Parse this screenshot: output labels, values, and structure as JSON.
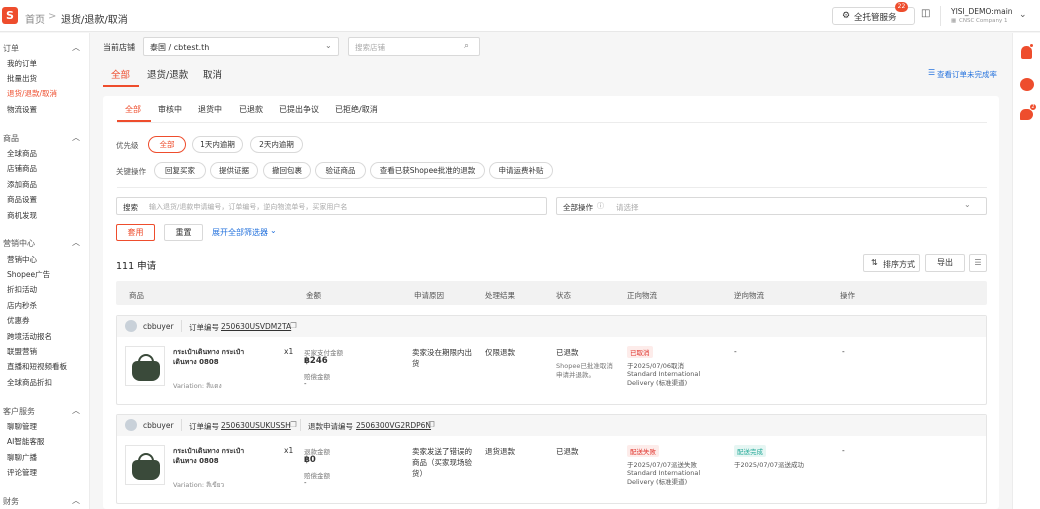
{
  "breadcrumb": {
    "home": "首页",
    "sep": ">",
    "current": "退货/退款/取消"
  },
  "topbar": {
    "managed_service": "全托管服务",
    "badge": "22",
    "user": "YISI_DEMO:main",
    "company": "CNSC Company 1",
    "logo": "S"
  },
  "sidebar": {
    "orders": {
      "title": "订单",
      "items": [
        "我的订单",
        "批量出货",
        "退货/退款/取消",
        "物流设置"
      ]
    },
    "products": {
      "title": "商品",
      "items": [
        "全球商品",
        "店铺商品",
        "添加商品",
        "商品设置",
        "商机发现"
      ]
    },
    "marketing": {
      "title": "营销中心",
      "items": [
        "营销中心",
        "Shopee广告",
        "折扣活动",
        "店内秒杀",
        "优惠券",
        "跨境活动报名",
        "联盟营销",
        "直播和短视频看板",
        "全球商品折扣"
      ]
    },
    "service": {
      "title": "客户服务",
      "items": [
        "聊聊管理",
        "AI智能客服",
        "聊聊广播",
        "评论管理"
      ]
    },
    "finance": {
      "title": "财务"
    }
  },
  "filters": {
    "store_label": "当前店铺",
    "store_value": "泰国 / cbtest.th",
    "store_search_placeholder": "搜索店铺"
  },
  "top_tabs": [
    "全部",
    "退货/退款",
    "取消"
  ],
  "view_rate": "查看订单未完成率",
  "sub_tabs": [
    "全部",
    "审核中",
    "退货中",
    "已退款",
    "已提出争议",
    "已拒绝/取消"
  ],
  "priority": {
    "label": "优先级",
    "options": [
      "全部",
      "1天内逾期",
      "2天内逾期"
    ]
  },
  "key_actions": {
    "label": "关键操作",
    "options": [
      "回复买家",
      "提供证据",
      "撤回包裹",
      "验证商品",
      "查看已获Shopee批准的退款",
      "申请运费补贴"
    ]
  },
  "search": {
    "label": "搜索",
    "placeholder": "输入退货/退款申请编号，订单编号，逆向物流单号，买家用户名",
    "ops_label": "全部操作",
    "ops_placeholder": "请选择"
  },
  "buttons": {
    "apply": "套用",
    "reset": "重置",
    "expand": "展开全部筛选器",
    "sort": "排序方式",
    "export": "导出"
  },
  "count": "111 申请",
  "table_headers": [
    "商品",
    "金额",
    "申请原因",
    "处理结果",
    "状态",
    "正向物流",
    "逆向物流",
    "操作"
  ],
  "rows": [
    {
      "buyer": "cbbuyer",
      "order_label": "订单编号",
      "order_no": "250630USVDM2TA",
      "return_label": "",
      "return_no": "",
      "product": "กระเป๋าเดินทาง กระเป๋าเดินทาง 0808",
      "variation": "Variation: สีแดง",
      "qty": "x1",
      "amount_label": "买家支付金额",
      "amount": "฿246",
      "comp_label": "赔偿金额",
      "comp": "-",
      "reason": "卖家没在期限内出货",
      "result": "仅限退款",
      "status": "已退款",
      "status_note": "Shopee已批准取消申请并退款。",
      "fwd_tag": "已取消",
      "fwd_date": "于2025/07/06取消",
      "fwd_carrier": "Standard International Delivery (标准渠道)",
      "rev_tag": "",
      "rev_date": "",
      "rev_dash": "-",
      "op": "-"
    },
    {
      "buyer": "cbbuyer",
      "order_label": "订单编号",
      "order_no": "250630USUKUSSH",
      "return_label": "退款申请编号",
      "return_no": "2506300VG2RDP6N",
      "product": "กระเป๋าเดินทาง กระเป๋าเดินทาง 0808",
      "variation": "Variation: สีเขียว",
      "qty": "x1",
      "amount_label": "退款金额",
      "amount": "฿0",
      "comp_label": "赔偿金额",
      "comp": "-",
      "reason": "卖家发送了错误的商品（买家现场验货）",
      "result": "退货退款",
      "status": "已退款",
      "status_note": "",
      "fwd_tag": "配送失败",
      "fwd_date": "于2025/07/07派送失败",
      "fwd_carrier": "Standard International Delivery (标准渠道)",
      "rev_tag": "配送完成",
      "rev_date": "于2025/07/07派送成功",
      "rev_dash": "",
      "op": "-"
    }
  ],
  "colors": {
    "brand": "#ee4d2d",
    "link": "#2673dd",
    "success": "#26aa99"
  }
}
